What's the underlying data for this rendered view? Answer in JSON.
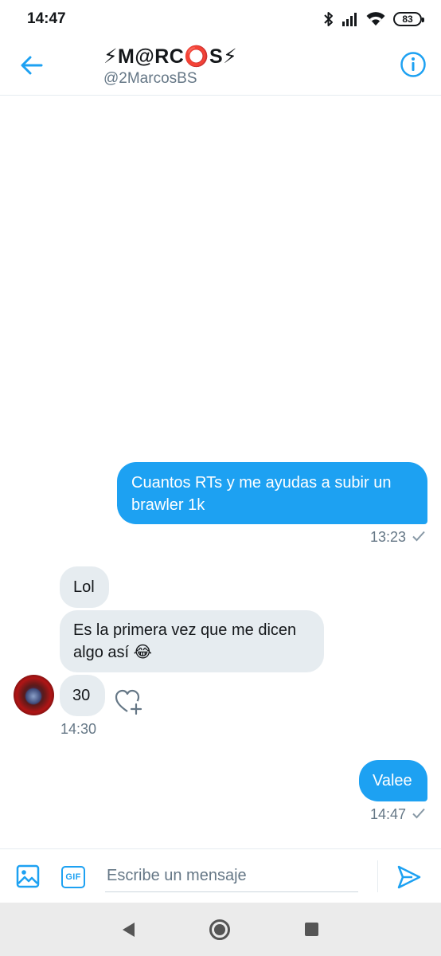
{
  "status_bar": {
    "time": "14:47",
    "battery": "83",
    "icons": [
      "bluetooth-icon",
      "signal-icon",
      "wifi-icon",
      "battery-icon"
    ]
  },
  "header": {
    "name": "⚡M@RC⭕S⚡",
    "handle": "@2MarcosBS",
    "icons": [
      "back-arrow-icon",
      "info-icon"
    ]
  },
  "messages": [
    {
      "direction": "out",
      "lines": [
        "Cuantos RTs y me ayudas a subir un",
        "brawler 1k"
      ],
      "time": "13:23",
      "status": "sent"
    },
    {
      "direction": "in",
      "lines": [
        "Lol"
      ]
    },
    {
      "direction": "in",
      "lines": [
        "Es la primera vez que me dicen",
        "algo así 😂"
      ]
    },
    {
      "direction": "in",
      "lines": [
        "30"
      ],
      "time": "14:30"
    },
    {
      "direction": "out",
      "lines": [
        "Valee"
      ],
      "time": "14:47",
      "status": "sent"
    }
  ],
  "composer": {
    "placeholder": "Escribe un mensaje",
    "gif_label": "GIF",
    "icons": [
      "image-icon",
      "gif-icon",
      "send-icon"
    ]
  },
  "nav_bar": {
    "icons": [
      "nav-back-icon",
      "nav-home-icon",
      "nav-recent-icon"
    ]
  },
  "colors": {
    "accent": "#1da1f2",
    "incoming_bubble": "#e6ecf0",
    "secondary_text": "#657786"
  }
}
